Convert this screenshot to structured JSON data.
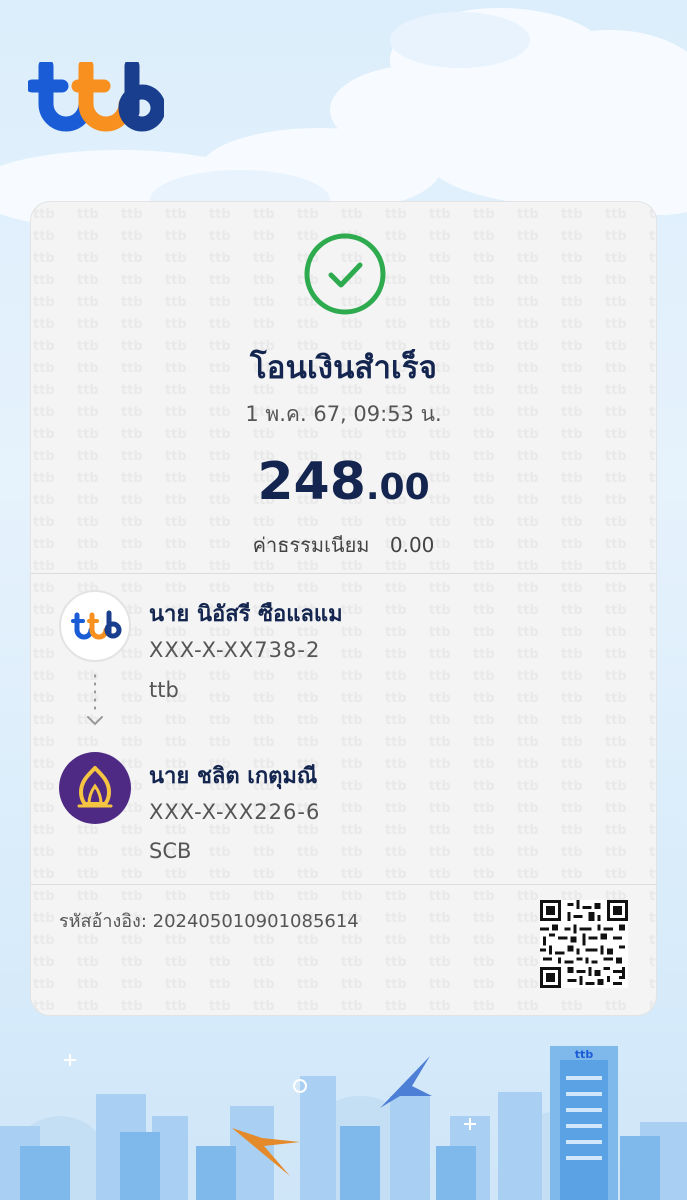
{
  "brand": {
    "logo_text": "ttb"
  },
  "receipt": {
    "title": "โอนเงินสำเร็จ",
    "datetime": "1 พ.ค. 67, 09:53 น.",
    "amount_integer": "248",
    "amount_decimal": ".00",
    "fee_label": "ค่าธรรมเนียม",
    "fee_value": "0.00"
  },
  "sender": {
    "name": "นาย นิอัสรี ซือแลแม",
    "account": "XXX-X-XX738-2",
    "bank": "ttb",
    "bank_logo_text": "ttb"
  },
  "receiver": {
    "name": "นาย ชลิต เกตุมณี",
    "account": "XXX-X-XX226-6",
    "bank": "SCB"
  },
  "reference": {
    "text": "รหัสอ้างอิง: 202405010901085614"
  },
  "colors": {
    "navy": "#14264f",
    "ttb_blue": "#1a5cd6",
    "ttb_orange": "#f7901e",
    "success_green": "#2eaa4f",
    "scb_purple": "#4e2a84"
  },
  "icons": [
    "check-circle-icon",
    "chevron-down-icon",
    "qr-code-icon",
    "scb-logo-icon"
  ]
}
